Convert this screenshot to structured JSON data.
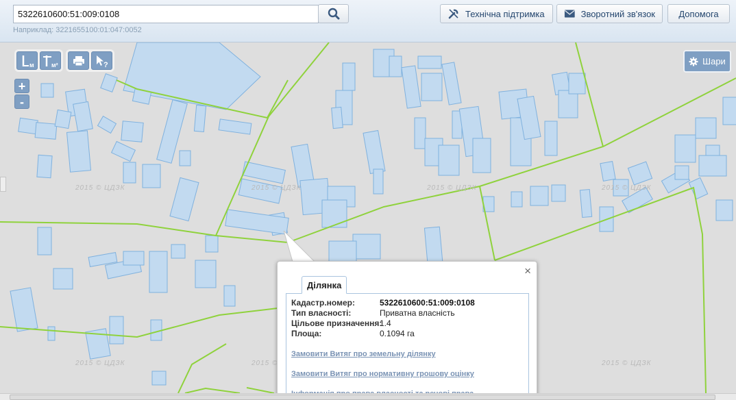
{
  "search": {
    "value": "5322610600:51:009:0108",
    "hint": "Наприклад: 3221655100:01:047:0052"
  },
  "header": {
    "support_label": "Технічна підтримка",
    "feedback_label": "Зворотний зв'язок",
    "help_label": "Допомога"
  },
  "map": {
    "layers_label": "Шари",
    "zoom_in": "+",
    "zoom_out": "-",
    "tool_line_label": "м",
    "tool_area_label": "м²",
    "watermark": "2015 © ЦДЗК"
  },
  "popup": {
    "tab_label": "Ділянка",
    "close": "×",
    "fields": [
      {
        "key": "Кадастр.номер:",
        "value": "5322610600:51:009:0108"
      },
      {
        "key": "Тип власності:",
        "value": "Приватна власність"
      },
      {
        "key": "Цільове призначення:",
        "value": "1.4"
      },
      {
        "key": "Площа:",
        "value": "0.1094 га"
      }
    ],
    "links": [
      "Замовити Витяг про земельну ділянку",
      "Замовити Витяг про нормативну грошову оцінку",
      "Інформація про права власності та речові права"
    ]
  },
  "colors": {
    "parcel_fill": "#c2daf0",
    "parcel_stroke": "#7fb1de",
    "boundary": "#8fd23c",
    "button": "#7f9fc3"
  }
}
